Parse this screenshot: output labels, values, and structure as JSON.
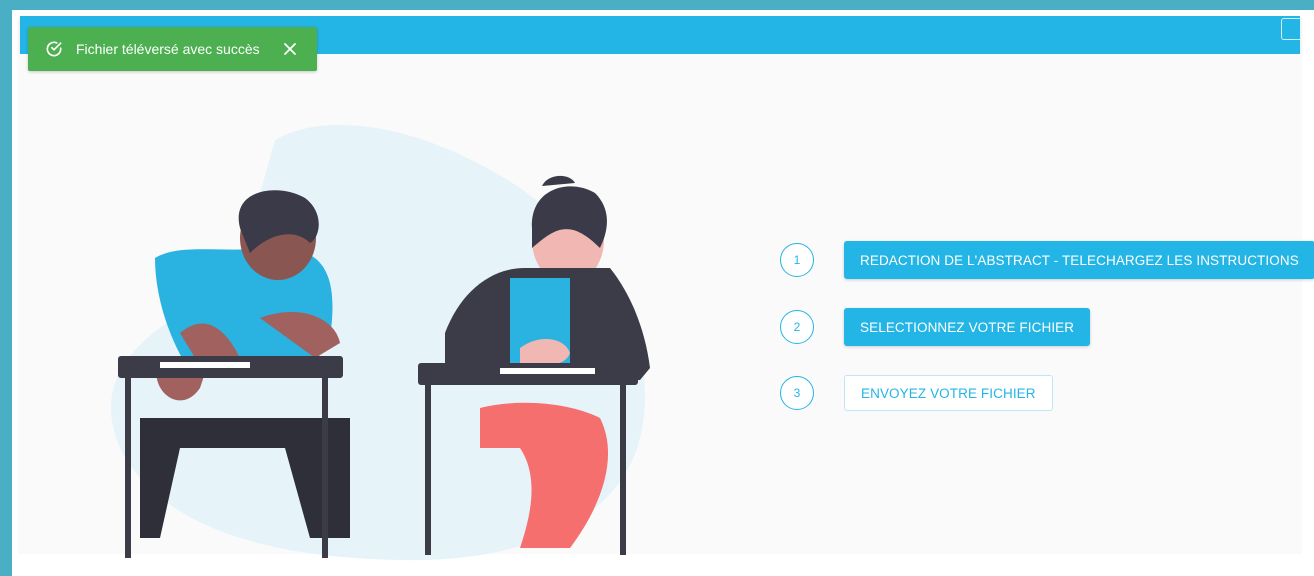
{
  "toast": {
    "message": "Fichier téléversé avec succès",
    "icon": "check-circle-icon",
    "close_icon": "close-icon",
    "color": "#4caf50"
  },
  "theme": {
    "accent": "#23b5e6",
    "frame_border": "#4aaec4"
  },
  "steps": [
    {
      "number": "1",
      "label": "REDACTION DE L'ABSTRACT - TELECHARGEZ LES INSTRUCTIONS"
    },
    {
      "number": "2",
      "label": "SELECTIONNEZ VOTRE FICHIER"
    },
    {
      "number": "3",
      "label": "ENVOYEZ VOTRE FICHIER"
    }
  ]
}
